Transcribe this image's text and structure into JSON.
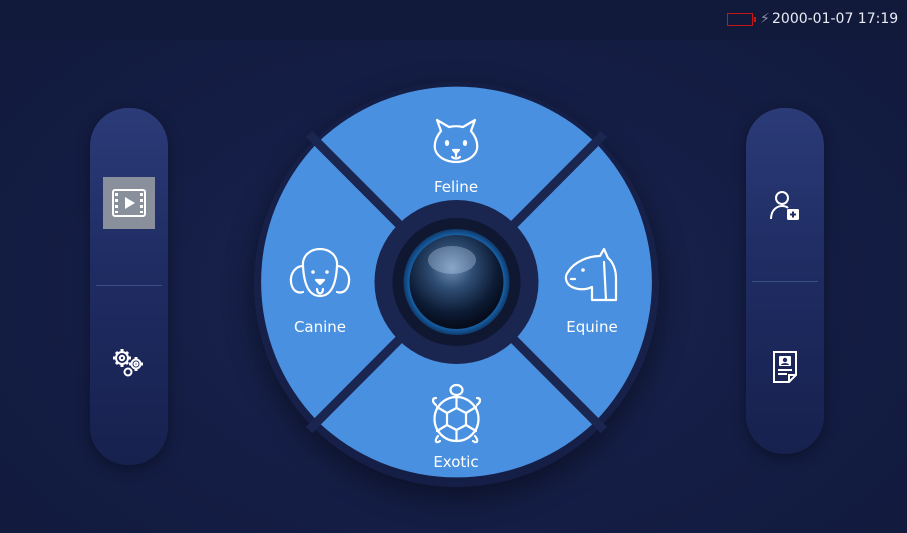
{
  "status_bar": {
    "datetime": "2000-01-07 17:19",
    "battery_color": "#c41818",
    "charging_icon": "bolt-icon"
  },
  "left_panel": {
    "buttons": [
      {
        "icon": "video-playback-icon",
        "selected": true
      },
      {
        "icon": "settings-gears-icon",
        "selected": false
      }
    ]
  },
  "right_panel": {
    "buttons": [
      {
        "icon": "add-patient-icon"
      },
      {
        "icon": "report-icon"
      }
    ]
  },
  "species_wheel": {
    "segment_color": "#4a90e0",
    "segments": [
      {
        "label": "Feline",
        "icon": "cat-icon"
      },
      {
        "label": "Equine",
        "icon": "horse-icon"
      },
      {
        "label": "Exotic",
        "icon": "turtle-icon"
      },
      {
        "label": "Canine",
        "icon": "dog-icon"
      }
    ],
    "center_button_icon": "probe-lens-icon"
  }
}
